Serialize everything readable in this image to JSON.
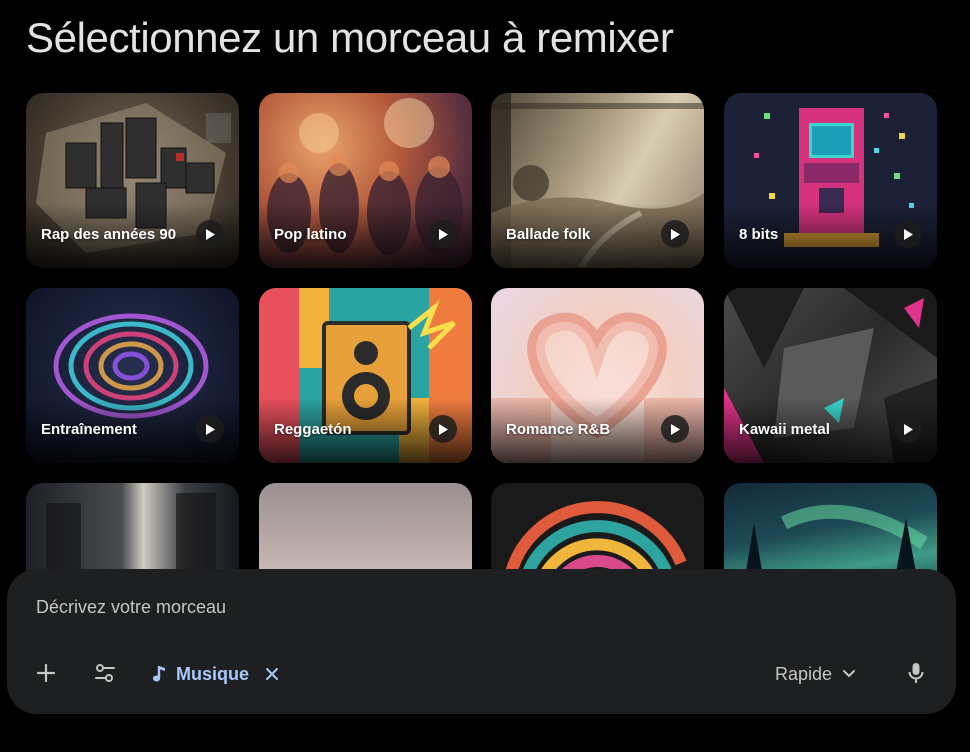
{
  "header": {
    "title": "Sélectionnez un morceau à remixer"
  },
  "tracks": [
    {
      "label": "Rap des années 90"
    },
    {
      "label": "Pop latino"
    },
    {
      "label": "Ballade folk"
    },
    {
      "label": "8 bits"
    },
    {
      "label": "Entraînement"
    },
    {
      "label": "Reggaetón"
    },
    {
      "label": "Romance R&B"
    },
    {
      "label": "Kawaii metal"
    }
  ],
  "composer": {
    "placeholder": "Décrivez votre morceau",
    "chip_label": "Musique",
    "speed_label": "Rapide"
  },
  "icons": {
    "add": "plus-icon",
    "tools": "sliders-icon",
    "music": "music-note-icon",
    "remove": "close-icon",
    "dropdown": "chevron-down-icon",
    "mic": "microphone-icon",
    "play": "play-icon"
  },
  "colors": {
    "accent": "#a8c7fa",
    "panel": "#1e1f20",
    "background": "#000000"
  }
}
